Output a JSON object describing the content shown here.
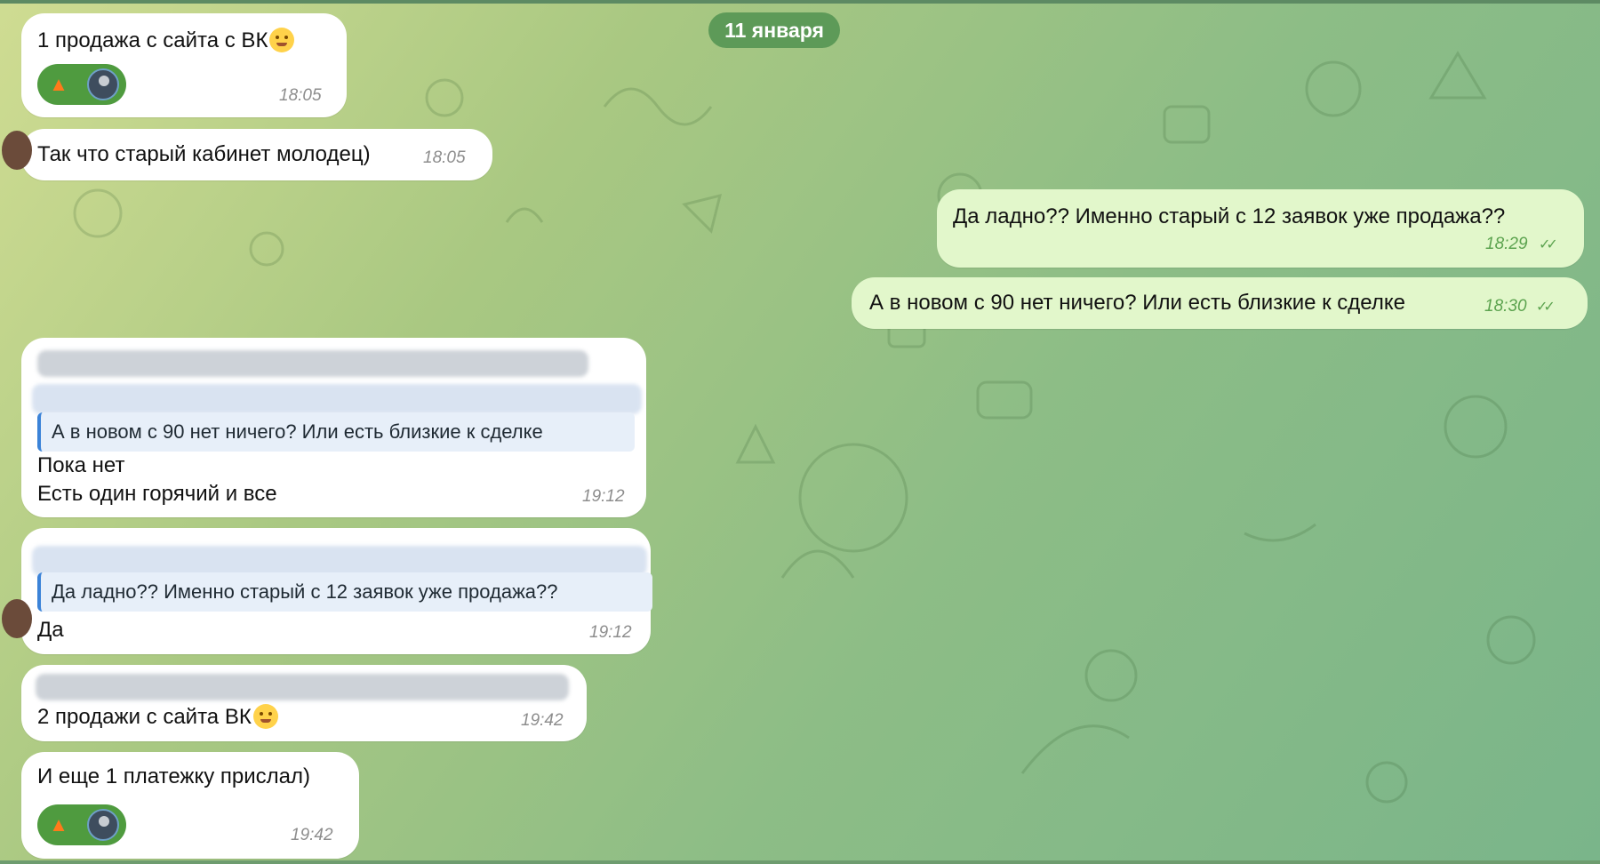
{
  "date_separator": "11 января",
  "messages": [
    {
      "text": "1 продажа с сайта с ВК",
      "time": "18:05",
      "direction": "in",
      "emoji": "partying-face",
      "reactions": [
        "fire",
        "avatar"
      ]
    },
    {
      "text": "Так что старый кабинет молодец)",
      "time": "18:05",
      "direction": "in"
    },
    {
      "text": "Да ладно?? Именно старый с 12 заявок уже продажа??",
      "time": "18:29",
      "direction": "out",
      "status": "read"
    },
    {
      "text": "А в новом с 90 нет ничего? Или есть близкие к сделке",
      "time": "18:30",
      "direction": "out",
      "status": "read"
    },
    {
      "reply_quote": "А в новом с 90 нет ничего? Или есть близкие к сделке",
      "line1": "Пока нет",
      "line2": "Есть один горячий и все",
      "time": "19:12",
      "direction": "in"
    },
    {
      "reply_quote": "Да ладно?? Именно старый с 12 заявок уже продажа??",
      "text": "Да",
      "time": "19:12",
      "direction": "in"
    },
    {
      "text": "2 продажи с сайта ВК",
      "time": "19:42",
      "direction": "in",
      "emoji": "slightly-smiling-face"
    },
    {
      "text": "И еще 1 платежку прислал)",
      "time": "19:42",
      "direction": "in",
      "reactions": [
        "fire",
        "avatar"
      ]
    }
  ],
  "colors": {
    "incoming_bubble": "#ffffff",
    "outgoing_bubble": "#e2f7cb",
    "date_pill": "#5d9a58",
    "reaction_pill": "#4f9b3f",
    "quote_bar": "#3b83d8"
  }
}
